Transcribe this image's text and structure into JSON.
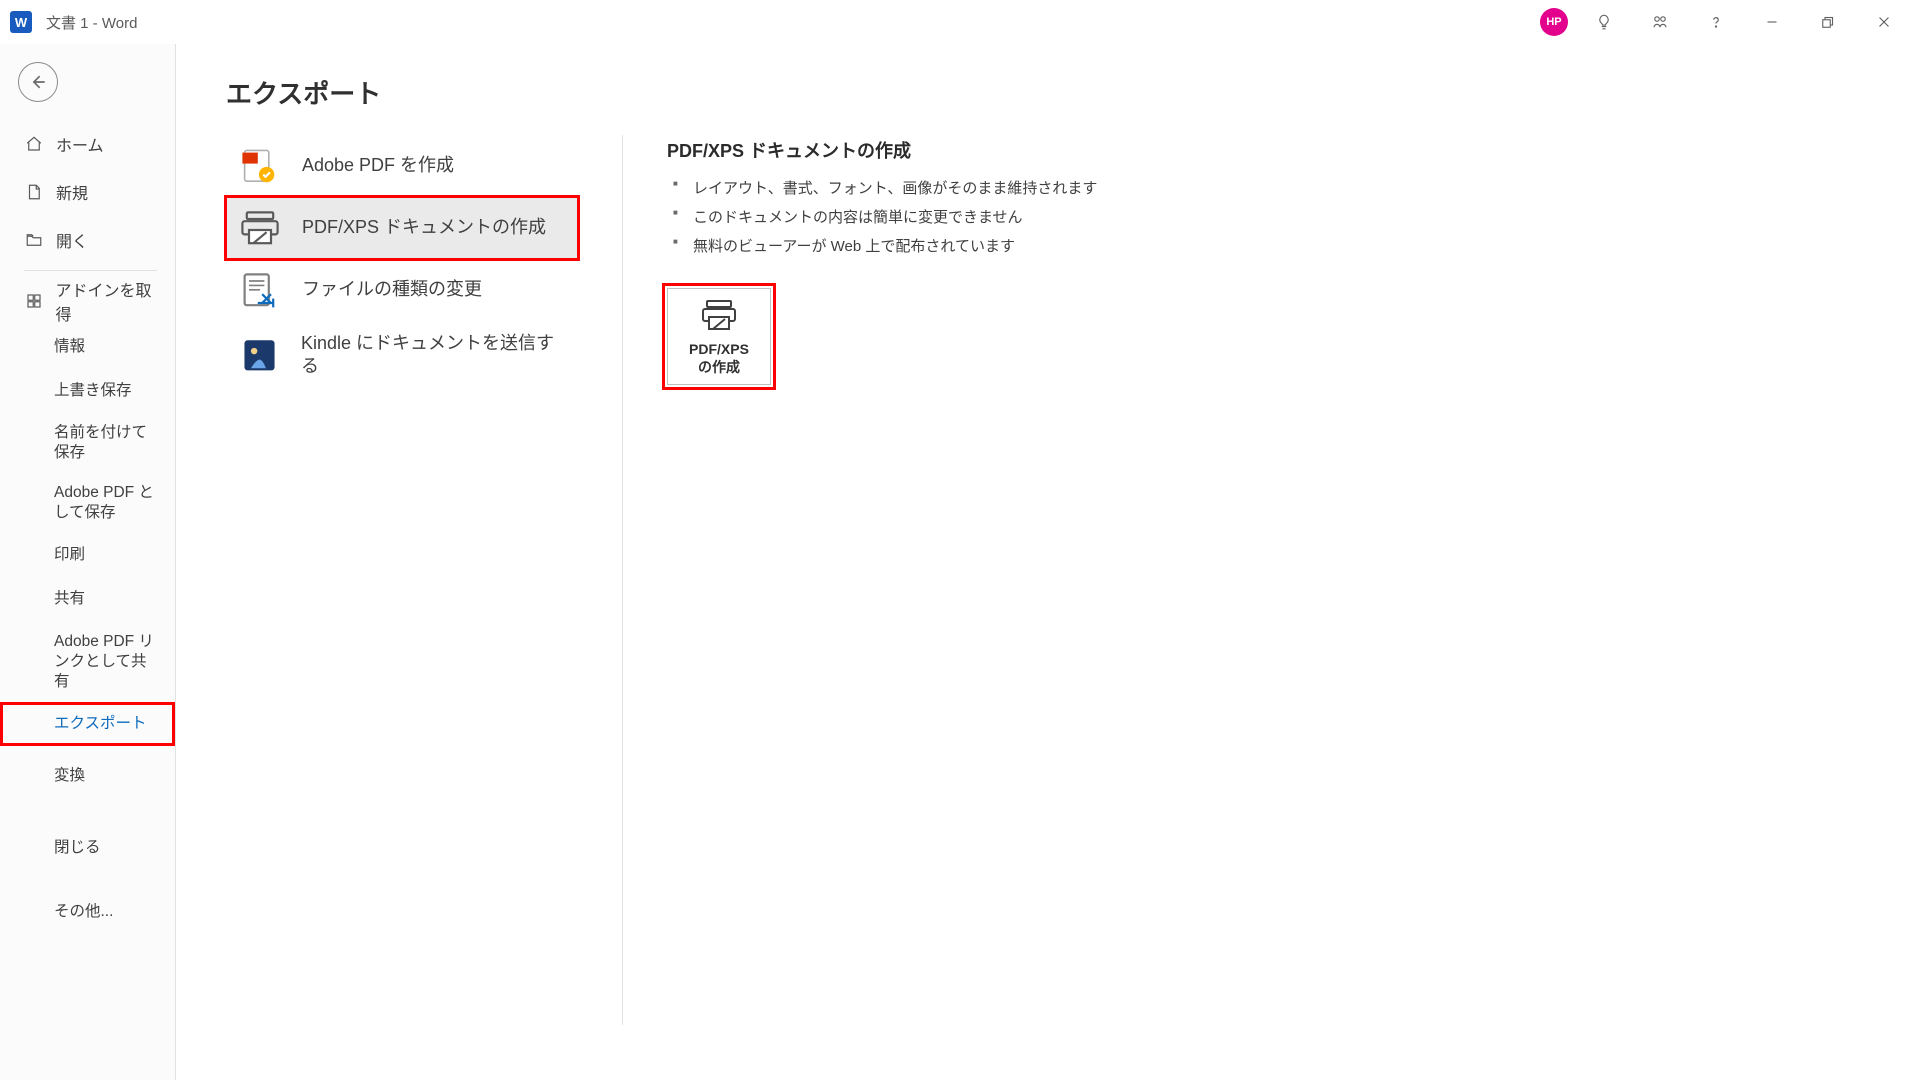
{
  "titlebar": {
    "app_letter": "W",
    "docname": "文書 1  -  Word",
    "avatar_initials": "HP"
  },
  "leftnav": {
    "home": "ホーム",
    "new": "新規",
    "open": "開く",
    "addins": "アドインを取得",
    "info": "情報",
    "save": "上書き保存",
    "saveas": "名前を付けて保存",
    "adobe_save": "Adobe PDF として保存",
    "print": "印刷",
    "share": "共有",
    "adobe_share": "Adobe PDF リンクとして共有",
    "export": "エクスポート",
    "transform": "変換",
    "close": "閉じる",
    "other": "その他..."
  },
  "page": {
    "title": "エクスポート"
  },
  "export_options": {
    "adobe_pdf": "Adobe PDF を作成",
    "pdf_xps": "PDF/XPS ドキュメントの作成",
    "change_type": "ファイルの種類の変更",
    "kindle": "Kindle にドキュメントを送信する"
  },
  "detail": {
    "title": "PDF/XPS ドキュメントの作成",
    "bullets": [
      "レイアウト、書式、フォント、画像がそのまま維持されます",
      "このドキュメントの内容は簡単に変更できません",
      "無料のビューアーが Web 上で配布されています"
    ],
    "button_label": "PDF/XPS\nの作成"
  }
}
